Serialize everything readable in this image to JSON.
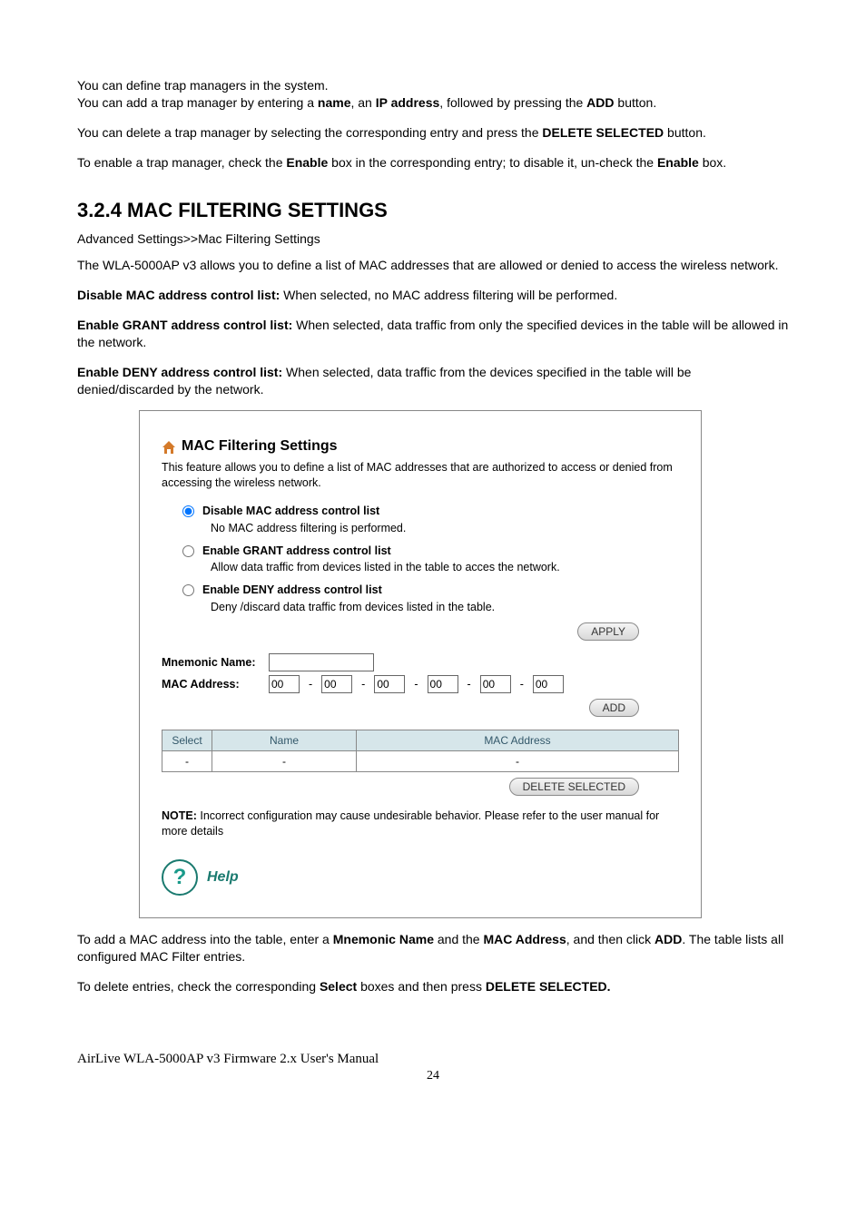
{
  "intro": {
    "line1_a": "You can define trap managers in the system.",
    "line2_a": "You can add a trap manager by entering a ",
    "line2_b": "name",
    "line2_c": ", an ",
    "line2_d": "IP address",
    "line2_e": ", followed by pressing the ",
    "line2_f": "ADD",
    "line2_g": " button.",
    "line3_a": "You can delete a trap manager by selecting the corresponding entry and press the ",
    "line3_b": "DELETE SELECTED",
    "line3_c": " button.",
    "line4_a": "To enable a trap manager, check the ",
    "line4_b": "Enable",
    "line4_c": " box in the corresponding entry; to disable it, un-check the ",
    "line4_d": "Enable",
    "line4_e": " box."
  },
  "section": {
    "heading": "3.2.4 MAC FILTERING SETTINGS",
    "breadcrumb": "Advanced Settings>>Mac Filtering Settings",
    "desc1": "The WLA-5000AP v3 allows you to define a list of MAC addresses that are allowed or denied to access the wireless network.",
    "desc2_label": "Disable MAC address control list:",
    "desc2_text": " When selected, no MAC address filtering will be performed.",
    "desc3_label": "Enable GRANT address control list:",
    "desc3_text": " When selected, data traffic from only the specified devices in the table will be allowed in the network.",
    "desc4_label": "Enable DENY address control list:",
    "desc4_text": " When selected, data traffic from the devices specified in the table will be denied/discarded by the network."
  },
  "panel": {
    "title": "MAC Filtering Settings",
    "desc": "This feature allows you to define a list of MAC addresses that are authorized to access or denied from accessing the wireless network.",
    "radios": {
      "disable_label": "Disable MAC address control list",
      "disable_desc": "No MAC address filtering is performed.",
      "grant_label": "Enable GRANT address control list",
      "grant_desc": "Allow data traffic from devices listed in the table to acces the network.",
      "deny_label": "Enable DENY address control list",
      "deny_desc": "Deny /discard data traffic from devices listed in the table.",
      "selected": "disable"
    },
    "apply_btn": "APPLY",
    "mnemonic_label": "Mnemonic Name:",
    "mnemonic_value": "",
    "mac_label": "MAC Address:",
    "mac_values": [
      "00",
      "00",
      "00",
      "00",
      "00",
      "00"
    ],
    "mac_sep": "-",
    "add_btn": "ADD",
    "table": {
      "headers": {
        "select": "Select",
        "name": "Name",
        "mac": "MAC Address"
      },
      "row": {
        "select": "-",
        "name": "-",
        "mac": "-"
      }
    },
    "delete_btn": "DELETE SELECTED",
    "note_label": "NOTE:",
    "note_text": " Incorrect configuration may cause undesirable behavior. Please refer to the user manual for more details",
    "help": "Help"
  },
  "outro": {
    "p1_a": "To add a MAC address into the table, enter a ",
    "p1_b": "Mnemonic Name",
    "p1_c": " and the ",
    "p1_d": "MAC Address",
    "p1_e": ", and then click ",
    "p1_f": "ADD",
    "p1_g": ". The table lists all configured MAC Filter entries.",
    "p2_a": "To delete entries, check the corresponding ",
    "p2_b": "Select",
    "p2_c": " boxes and then press ",
    "p2_d": "DELETE SELECTED."
  },
  "footer": {
    "text": "AirLive WLA-5000AP v3 Firmware 2.x User's Manual",
    "page": "24"
  }
}
